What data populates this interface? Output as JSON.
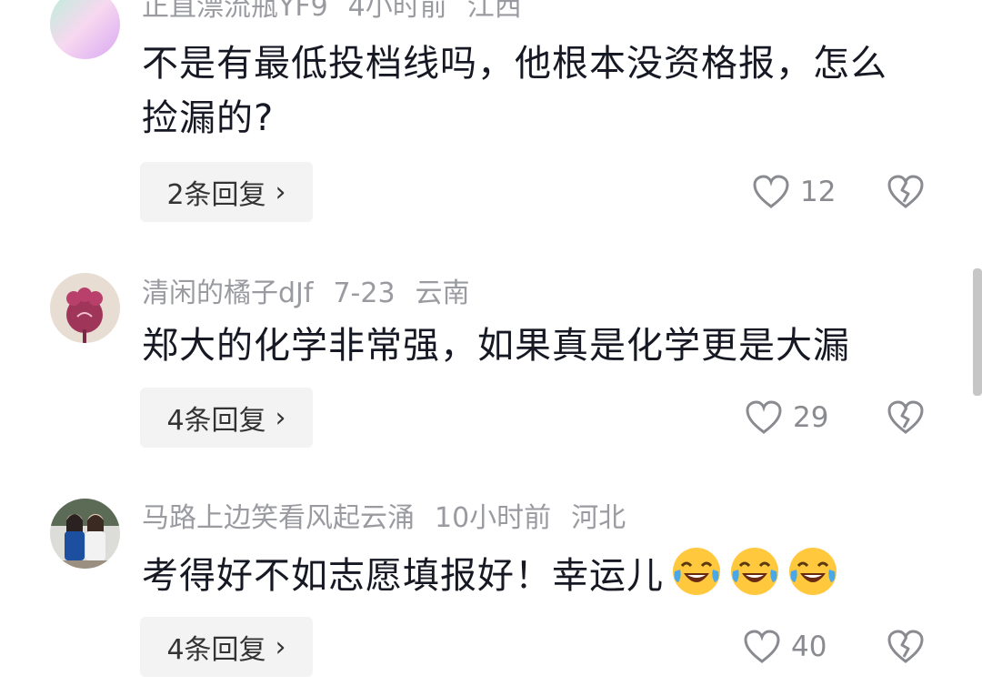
{
  "comments": [
    {
      "username": "正直漂流瓶YF9",
      "time": "4小时前",
      "location": "江西",
      "text": "不是有最低投档线吗，他根本没资格报，怎么捡漏的?",
      "reply_label": "2条回复",
      "likes": "12",
      "avatar": "gradient-avatar"
    },
    {
      "username": "清闲的橘子dJf",
      "time": "7-23",
      "location": "云南",
      "text": "郑大的化学非常强，如果真是化学更是大漏",
      "reply_label": "4条回复",
      "likes": "29",
      "avatar": "flower-avatar"
    },
    {
      "username": "马路上边笑看风起云涌",
      "time": "10小时前",
      "location": "河北",
      "text": "考得好不如志愿填报好！幸运儿",
      "emojis": [
        "laughing-tears-emoji",
        "laughing-tears-emoji",
        "laughing-tears-emoji"
      ],
      "reply_label": "4条回复",
      "likes": "40",
      "avatar": "photo-avatar"
    }
  ],
  "icons": {
    "reply_chevron": "›",
    "like": "heart-outline-icon",
    "dislike": "broken-heart-icon"
  },
  "colors": {
    "meta_text": "#9a9ba0",
    "body_text": "#161823",
    "reply_bg": "#f3f3f4",
    "icon": "#8a8b90"
  }
}
